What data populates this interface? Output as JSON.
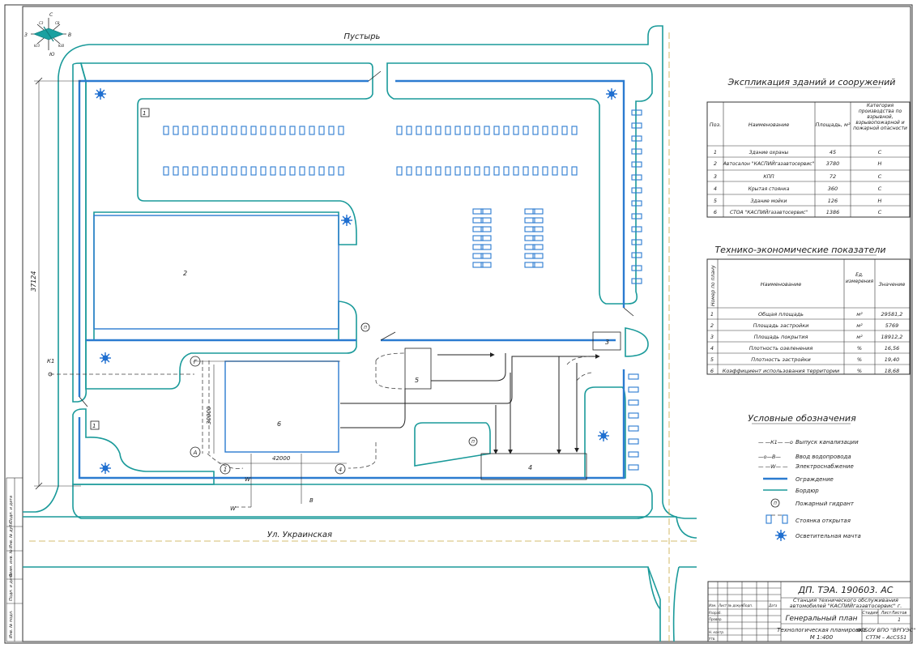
{
  "plan": {
    "top_road": "Пустырь",
    "bottom_road": "Ул. Украинская",
    "dims": {
      "height": "37124",
      "bldg_w": "42000",
      "bldg_h": "30000"
    },
    "buildings": [
      "1",
      "2",
      "3",
      "4",
      "5",
      "6",
      "1"
    ],
    "axes": {
      "a": "А",
      "g": "Г",
      "n1": "1",
      "n4": "4",
      "k1": "К1",
      "v": "В",
      "w1": "W",
      "w2": "W"
    },
    "hydrant": "П"
  },
  "compass": [
    "С",
    "Ю",
    "З",
    "В",
    "СЗ",
    "СВ",
    "ЮЗ",
    "ЮВ"
  ],
  "explication": {
    "title": "Экспликация зданий и сооружений",
    "headers": [
      "Поз.",
      "Наименование",
      "Площадь, м²",
      "Категория производства по взрывной, взрывопожарной и пожарной опасности"
    ],
    "rows": [
      [
        "1",
        "Здание охраны",
        "45",
        "С"
      ],
      [
        "2",
        "Автосалон \"КАСПИЙгазавтосервис\"",
        "3780",
        "Н"
      ],
      [
        "3",
        "КПП",
        "72",
        "С"
      ],
      [
        "4",
        "Крытая стоянка",
        "360",
        "С"
      ],
      [
        "5",
        "Здание мойки",
        "126",
        "Н"
      ],
      [
        "6",
        "СТОА \"КАСПИЙгазавтосервис\"",
        "1386",
        "С"
      ]
    ]
  },
  "teo": {
    "title": "Технико-экономические показатели",
    "headers": [
      "Номер по плану",
      "Наименование",
      "Ед. измерения",
      "Значение"
    ],
    "rows": [
      [
        "1",
        "Общая площадь",
        "м²",
        "29581,2"
      ],
      [
        "2",
        "Площадь застройки",
        "м²",
        "5769"
      ],
      [
        "3",
        "Площадь покрытия",
        "м²",
        "18912,2"
      ],
      [
        "4",
        "Плотность озеленения",
        "%",
        "16,56"
      ],
      [
        "5",
        "Плотность застройки",
        "%",
        "19,40"
      ],
      [
        "6",
        "Коэффициент использования территории",
        "%",
        "18,68"
      ]
    ]
  },
  "legend": {
    "title": "Условные обозначения",
    "items": [
      {
        "sym": "— —К1— —о",
        "label": "Выпуск канализации"
      },
      {
        "sym": "—о—В—",
        "label": "Ввод водопровода"
      },
      {
        "sym": "— —W— —",
        "label": "Электроснабжение"
      },
      {
        "sym": "",
        "label": "Ограждение"
      },
      {
        "sym": "",
        "label": "Бордюр"
      },
      {
        "sym": "П",
        "label": "Пожарный гидрант"
      },
      {
        "sym": "",
        "label": "Стоянка открытая"
      },
      {
        "sym": "",
        "label": "Осветительная мачта"
      }
    ]
  },
  "stamp": {
    "code": "ДП. ТЭА. 190603. АС",
    "project": "Станция технического обслуживания автомобилей \"КАСПИЙгазавтосервис\" г. Астрахани",
    "title": "Генеральный план",
    "subtitle": "Технологическая планировка",
    "scale": "М 1:400",
    "org1": "ФГБОУ ВПО \"ВРГУЭС\"",
    "org2": "СТТМ – АсС551",
    "col_labels": [
      "Изм.",
      "Лист",
      "№ докум.",
      "Подп.",
      "Дата"
    ],
    "row_labels": [
      "Разраб.",
      "Провер.",
      "",
      "Н. контр.",
      "Утв."
    ],
    "stage_labels": [
      "Стадия",
      "Лист",
      "Листов"
    ],
    "sheet": "1"
  },
  "side_stamp": [
    "Инв. № подл.",
    "Подп. и дата",
    "Взам. инв. №",
    "Инв. № дубл.",
    "Подп. и дата",
    "Справ. №",
    "Перв. примен."
  ]
}
